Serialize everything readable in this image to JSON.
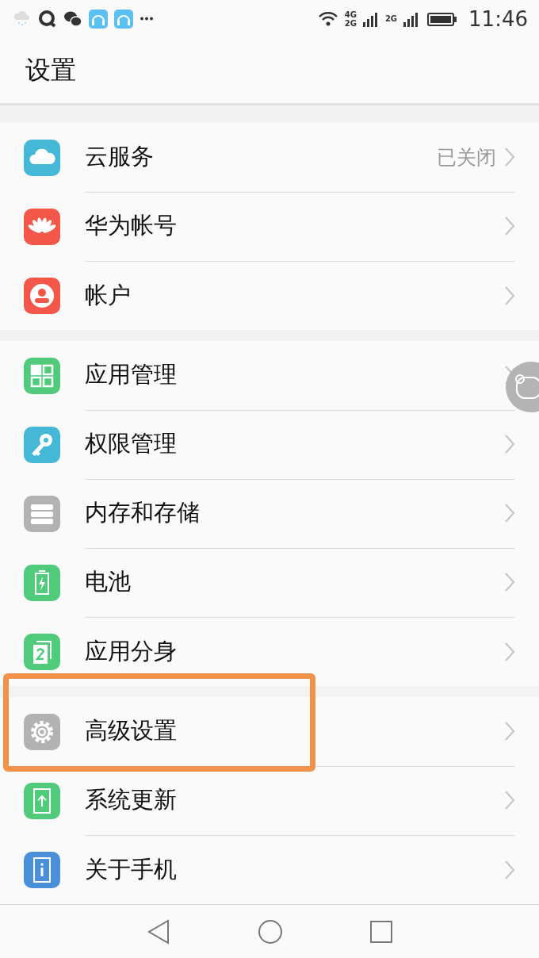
{
  "status_bar": {
    "network_1": "4G",
    "network_2": "2G",
    "network_3": "2G",
    "time": "11:46"
  },
  "header": {
    "title": "设置"
  },
  "groups": [
    {
      "items": [
        {
          "kind": "cloud",
          "label": "云服务",
          "value": "已关闭",
          "highlighted": false
        },
        {
          "kind": "flower",
          "label": "华为帐号",
          "highlighted": false
        },
        {
          "kind": "person",
          "label": "帐户",
          "highlighted": false
        }
      ]
    },
    {
      "items": [
        {
          "kind": "grid",
          "label": "应用管理",
          "highlighted": false
        },
        {
          "kind": "key",
          "label": "权限管理",
          "highlighted": false
        },
        {
          "kind": "storage",
          "label": "内存和存储",
          "highlighted": false
        },
        {
          "kind": "battery",
          "label": "电池",
          "highlighted": false
        },
        {
          "kind": "clone",
          "label": "应用分身",
          "highlighted": false
        }
      ]
    },
    {
      "items": [
        {
          "kind": "gear",
          "label": "高级设置",
          "highlighted": true
        },
        {
          "kind": "update",
          "label": "系统更新",
          "highlighted": false
        },
        {
          "kind": "info",
          "label": "关于手机",
          "highlighted": false
        }
      ]
    }
  ]
}
